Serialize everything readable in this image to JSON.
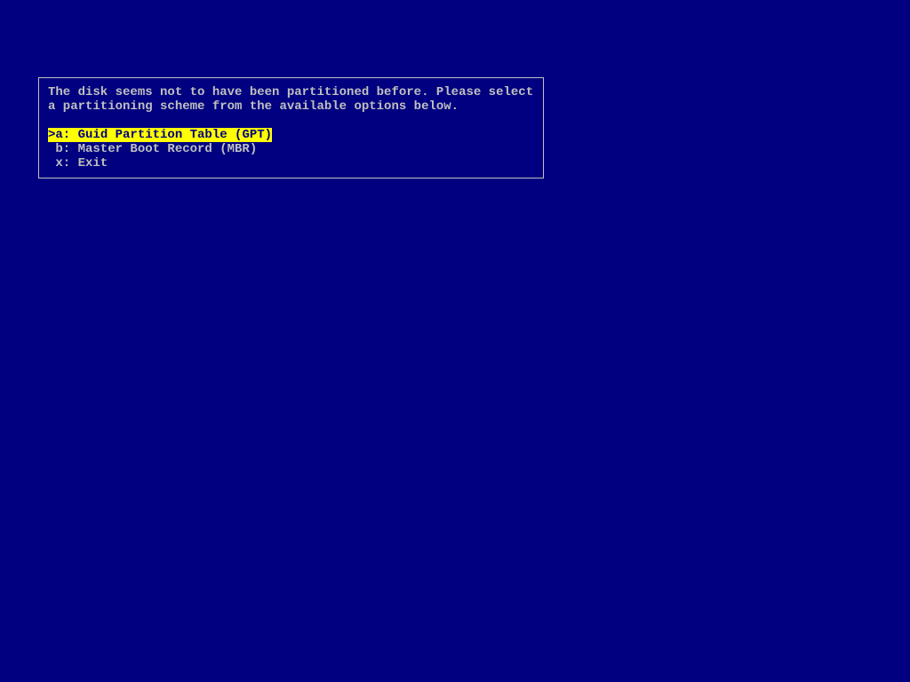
{
  "dialog": {
    "prompt_line1": "The disk seems not to have been partitioned before. Please select",
    "prompt_line2": "a partitioning scheme from the available options below.",
    "menu": {
      "selected_marker": ">",
      "items": [
        {
          "key": "a",
          "label": "a: Guid Partition Table (GPT)",
          "selected": true
        },
        {
          "key": "b",
          "label": " b: Master Boot Record (MBR)",
          "selected": false
        },
        {
          "key": "x",
          "label": " x: Exit",
          "selected": false
        }
      ]
    }
  }
}
